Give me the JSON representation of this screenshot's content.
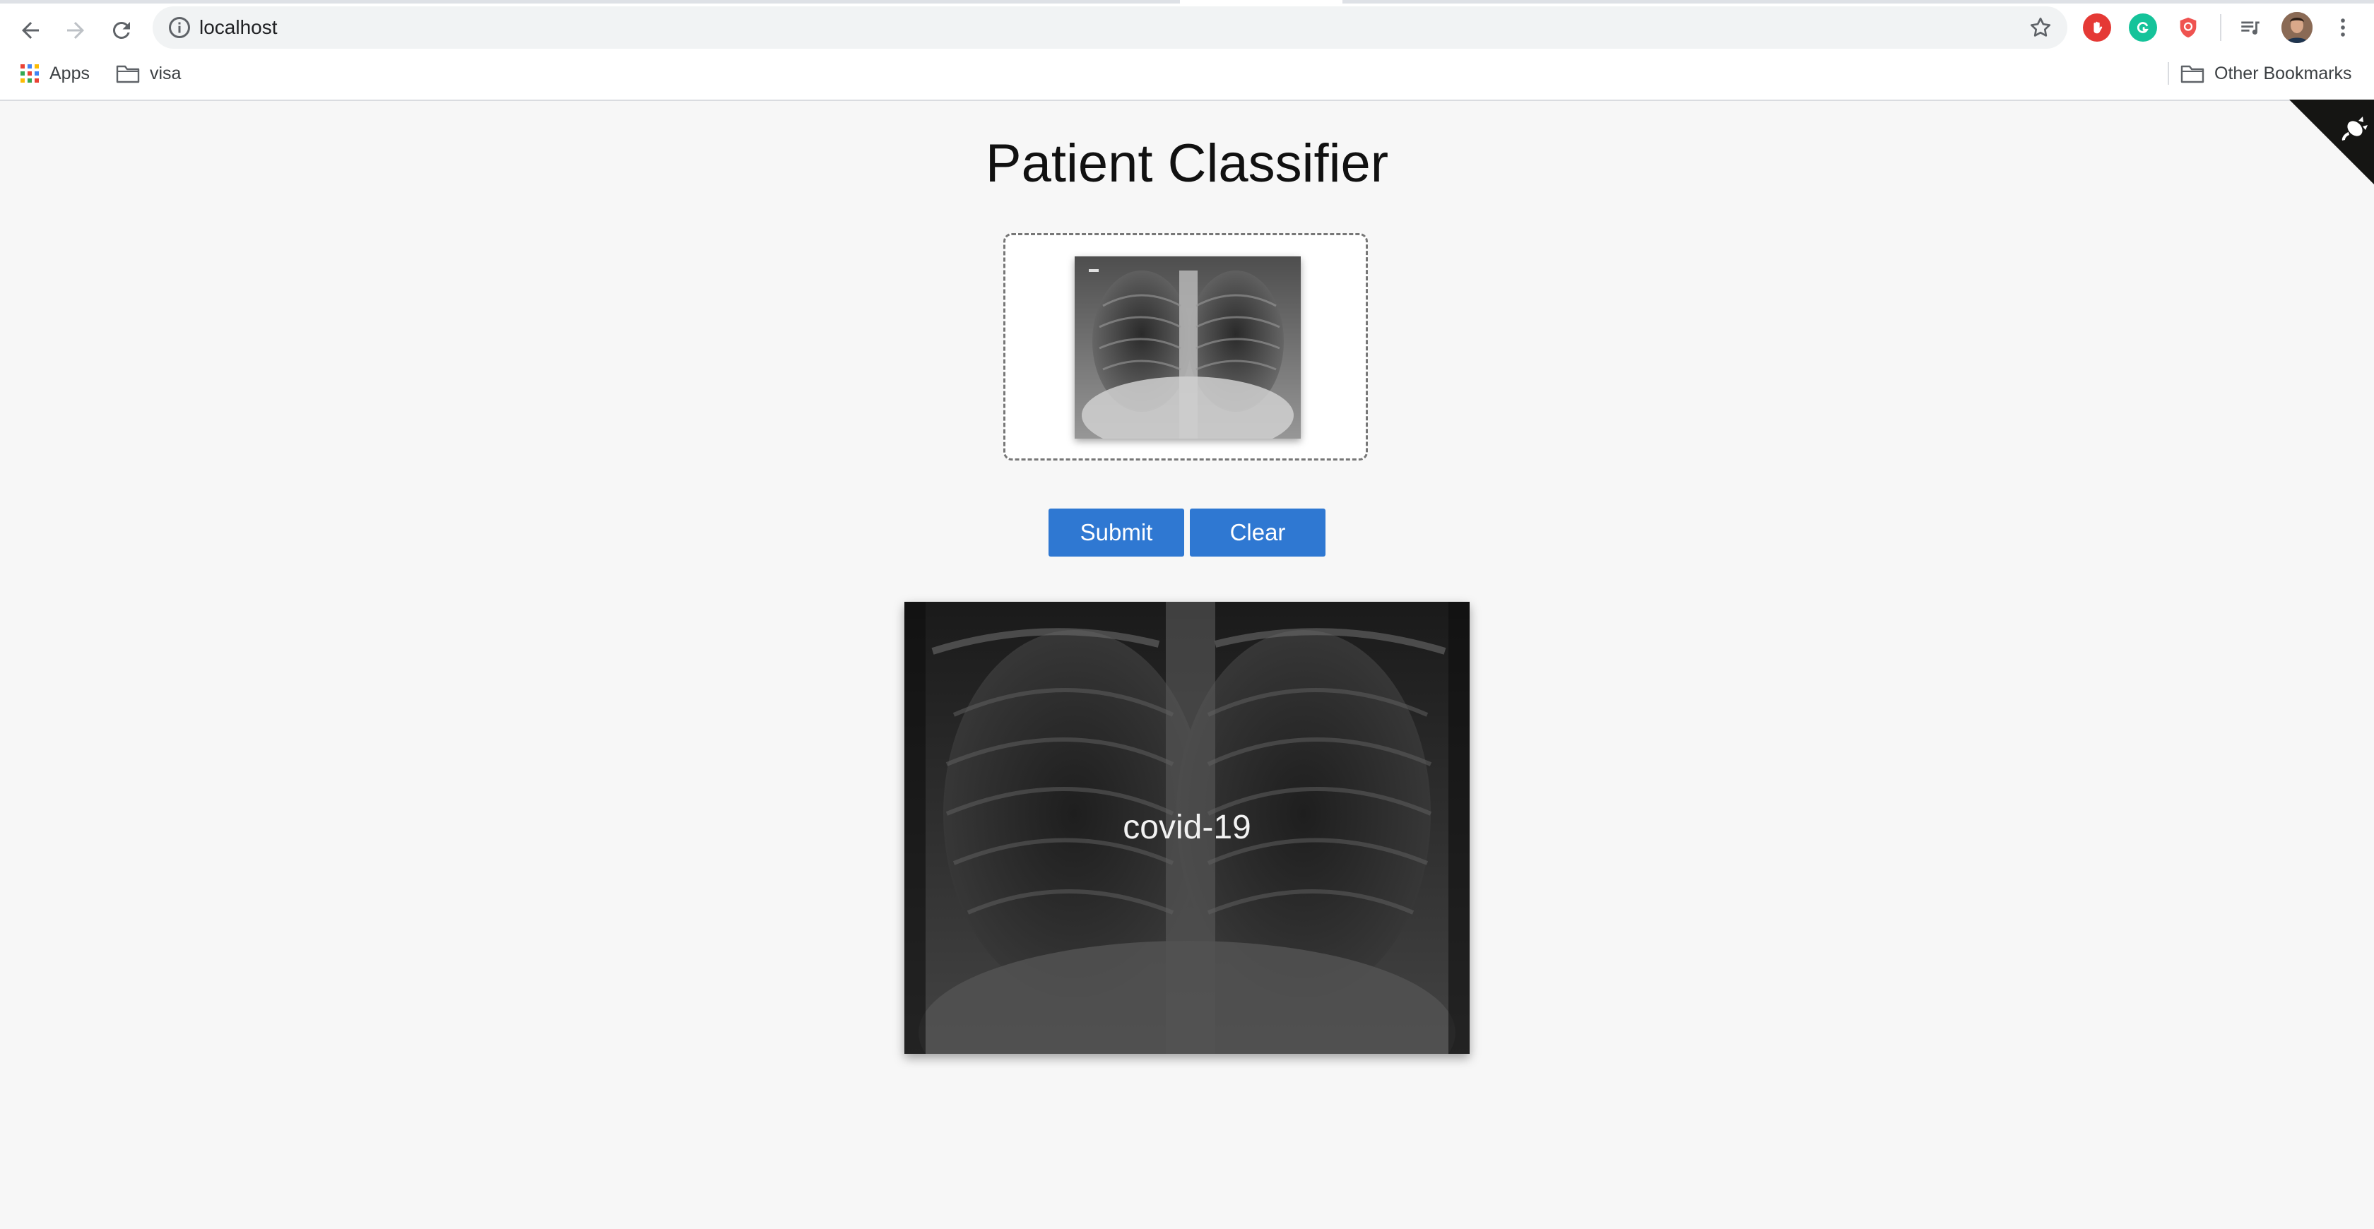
{
  "browser": {
    "url": "localhost",
    "bookmarks": {
      "apps_label": "Apps",
      "visa_label": "visa",
      "other_label": "Other Bookmarks"
    }
  },
  "page": {
    "title": "Patient Classifier",
    "submit_label": "Submit",
    "clear_label": "Clear",
    "result_label": "covid-19"
  },
  "colors": {
    "button_blue": "#2f78d2",
    "page_background": "#f7f7f7"
  }
}
